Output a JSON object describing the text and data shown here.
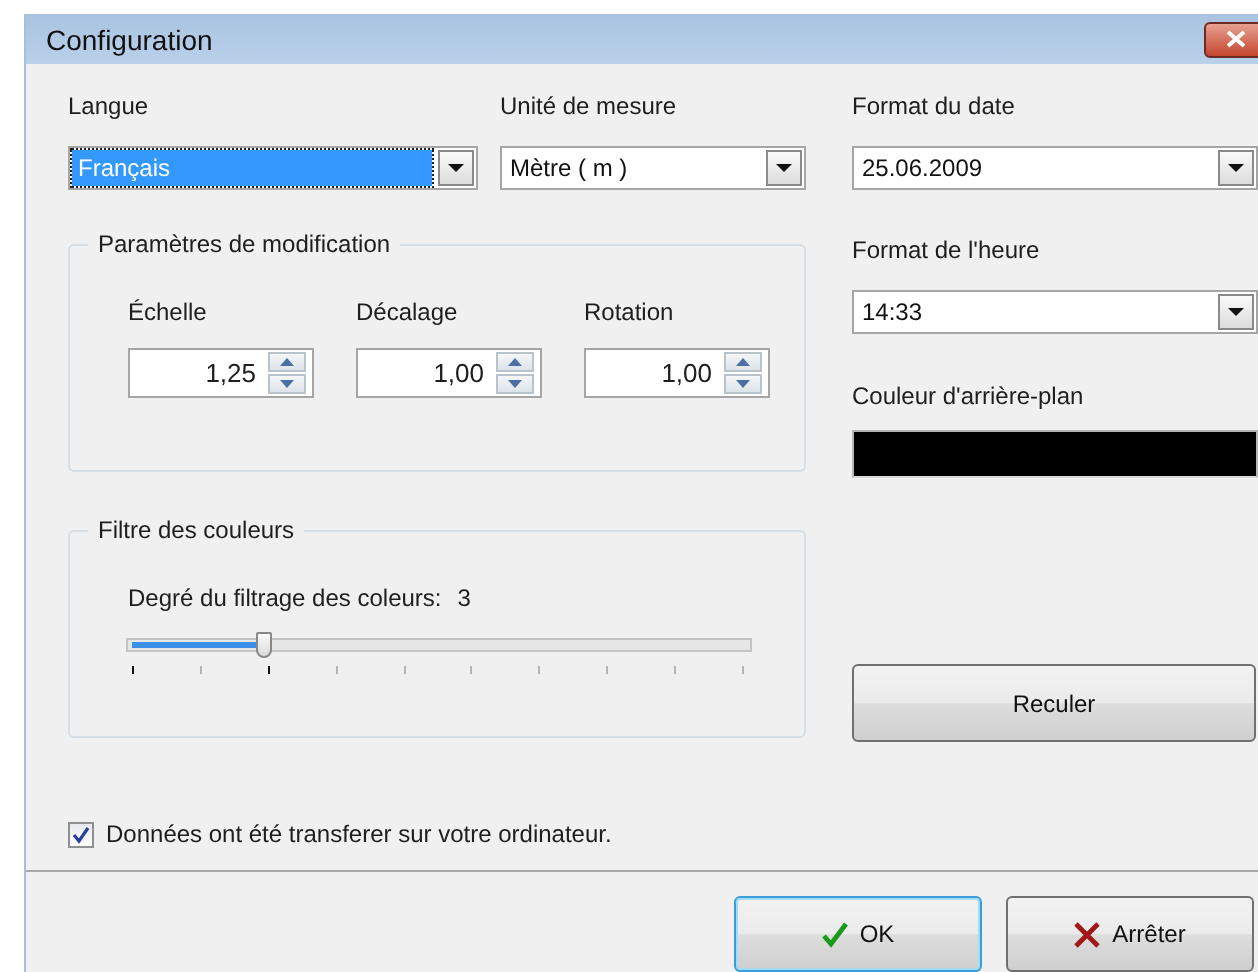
{
  "window": {
    "title": "Configuration"
  },
  "language": {
    "label": "Langue",
    "value": "Français",
    "focused": true
  },
  "unit": {
    "label": "Unité de mesure",
    "value": "Mètre ( m )"
  },
  "date_format": {
    "label": "Format du date",
    "value": "25.06.2009"
  },
  "modification": {
    "title": "Paramètres de modification",
    "spinners": [
      {
        "label": "Échelle",
        "value": "1,25"
      },
      {
        "label": "Décalage",
        "value": "1,00"
      },
      {
        "label": "Rotation",
        "value": "1,00"
      }
    ]
  },
  "color_filter": {
    "title": "Filtre des couleurs",
    "label": "Degré du filtrage des coleurs:",
    "reading": "3",
    "level": 0.22
  },
  "time_format": {
    "label": "Format de l'heure",
    "value": "14:33"
  },
  "background_color": {
    "label": "Couleur d'arrière-plan",
    "color": "#000000"
  },
  "reset_button": "Reculer",
  "transfer": {
    "label": "Données ont été transferer sur votre ordinateur.",
    "checked": true
  },
  "buttons": [
    {
      "kind": "ok",
      "label": "OK",
      "default": true
    },
    {
      "kind": "cancel",
      "label": "Arrêter",
      "default": false
    }
  ]
}
